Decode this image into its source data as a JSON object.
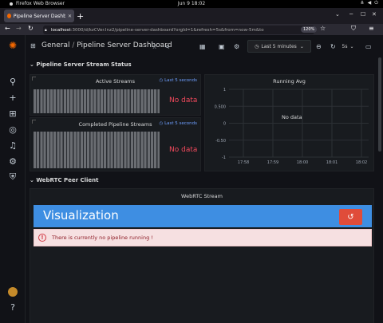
{
  "os": {
    "app_name": "Firefox Web Browser",
    "clock": "Jun 9  18:02"
  },
  "browser": {
    "tab_title": "Pipeline Server Dashboard",
    "url_host": "localhost",
    "url_path": ":3000/d/kzCVer.Inz2/pipeline-server-dashboard?orgId=1&refresh=5s&from=now-5m&to",
    "zoom": "120%"
  },
  "dashboard": {
    "folder": "General",
    "title": "Pipeline Server Dashboard",
    "time_range": "Last 5 minutes",
    "refresh": "5s"
  },
  "rows": [
    {
      "title": "Pipeline Server Stream Status"
    },
    {
      "title": "WebRTC Peer Client"
    }
  ],
  "panels": {
    "active_streams": {
      "title": "Active Streams",
      "time_link": "Last 5 seconds",
      "status": "No data"
    },
    "completed": {
      "title": "Completed Pipeline Streams",
      "time_link": "Last 5 seconds",
      "status": "No data"
    },
    "running_avg": {
      "title": "Running Avg",
      "status": "No data"
    },
    "webrtc": {
      "title": "WebRTC Stream",
      "viz_title": "Visualization",
      "alert": "There is currently no pipeline running !"
    }
  },
  "chart_data": {
    "type": "line",
    "title": "Running Avg",
    "x": [
      "17:58",
      "17:59",
      "18:00",
      "18:01",
      "18:02"
    ],
    "y_ticks": [
      "1",
      "0.500",
      "0",
      "-0.50",
      "-1"
    ],
    "ylim": [
      -1,
      1
    ],
    "series": [],
    "grid": true
  },
  "colors": {
    "accent_blue": "#3e8ee2",
    "no_data_red": "#f2495c",
    "reload_red": "#e04c3a",
    "grafana_orange": "#f46800"
  }
}
